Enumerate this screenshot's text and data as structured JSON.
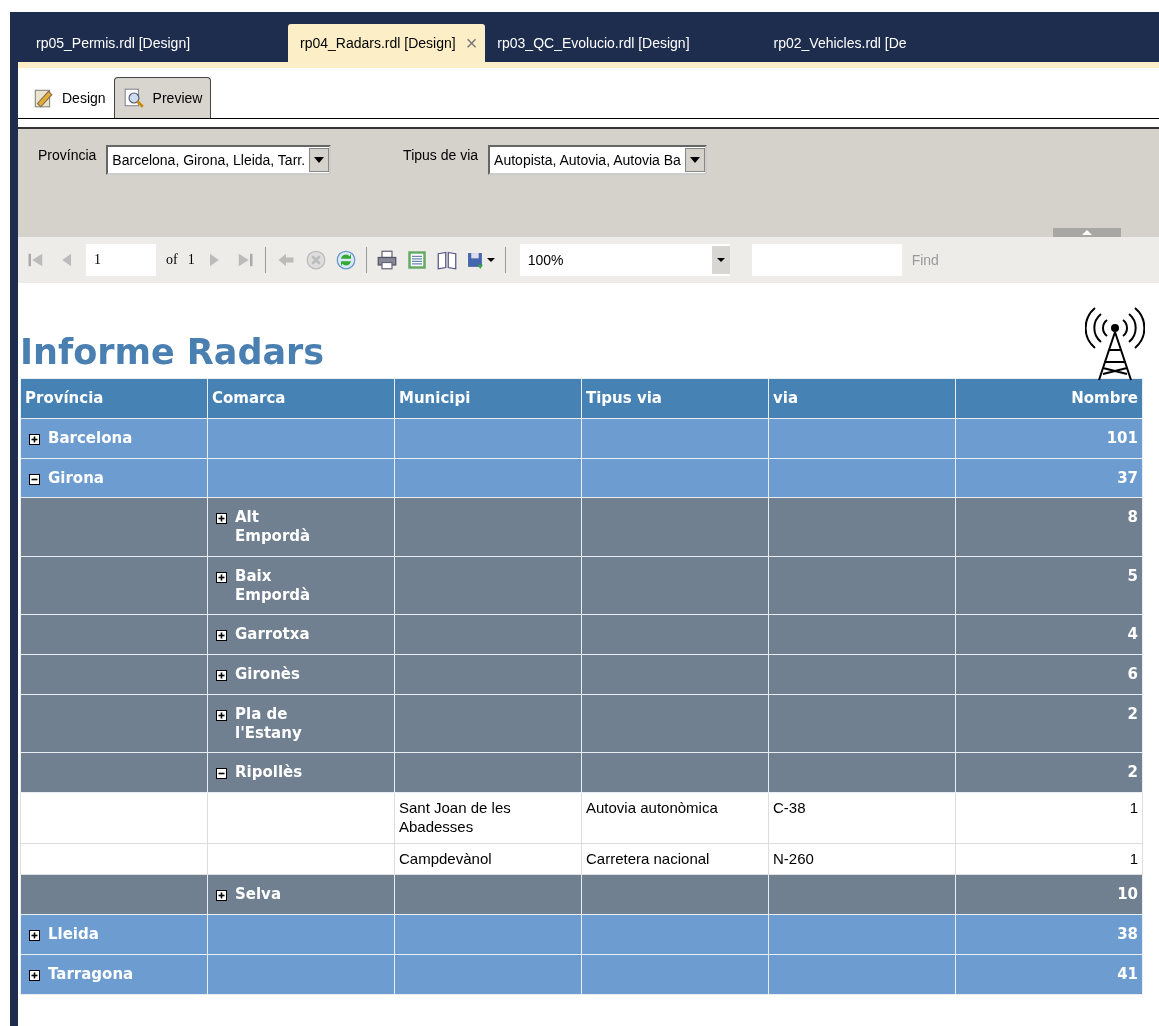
{
  "document_tabs": [
    {
      "label": "rp05_Permis.rdl [Design]",
      "selected": false
    },
    {
      "label": "rp04_Radars.rdl [Design]",
      "selected": true,
      "close": "×"
    },
    {
      "label": "rp03_QC_Evolucio.rdl [Design]",
      "selected": false
    },
    {
      "label": "rp02_Vehicles.rdl [De",
      "selected": false
    }
  ],
  "view_tabs": [
    {
      "label": "Design",
      "kind": "design",
      "selected": false
    },
    {
      "label": "Preview",
      "kind": "preview",
      "selected": true
    }
  ],
  "parameters": [
    {
      "label": "Província",
      "value": "Barcelona, Girona, Lleida, Tarr."
    },
    {
      "label": "Tipus de via",
      "value": "Autopista, Autovia, Autovia Ba"
    }
  ],
  "toolbar": {
    "page": "1",
    "of_label": "of",
    "page_count": "1",
    "zoom": "100%",
    "find_label": "Find",
    "find_disabled": true
  },
  "report": {
    "title": "Informe Radars",
    "columns": [
      "Província",
      "Comarca",
      "Municipi",
      "Tipus via",
      "via",
      "Nombre"
    ],
    "provinces": [
      {
        "name": "Barcelona",
        "count": "101",
        "expanded": false
      },
      {
        "name": "Girona",
        "count": "37",
        "expanded": true,
        "children": [
          {
            "name": "Alt Empordà",
            "count": "8",
            "expanded": false
          },
          {
            "name": "Baix Empordà",
            "count": "5",
            "expanded": false
          },
          {
            "name": "Garrotxa",
            "count": "4",
            "expanded": false
          },
          {
            "name": "Gironès",
            "count": "6",
            "expanded": false
          },
          {
            "name": "Pla de l'Estany",
            "count": "2",
            "expanded": false
          },
          {
            "name": "Ripollès",
            "count": "2",
            "expanded": true,
            "children": [
              {
                "municipi": "Sant Joan de les Abadesses",
                "tipus_via": "Autovia autonòmica",
                "via": "C-38",
                "nombre": "1"
              },
              {
                "municipi": "Campdevànol",
                "tipus_via": "Carretera nacional",
                "via": "N-260",
                "nombre": "1"
              }
            ]
          },
          {
            "name": "Selva",
            "count": "10",
            "expanded": false
          }
        ]
      },
      {
        "name": "Lleida",
        "count": "38",
        "expanded": false
      },
      {
        "name": "Tarragona",
        "count": "41",
        "expanded": false
      }
    ]
  }
}
